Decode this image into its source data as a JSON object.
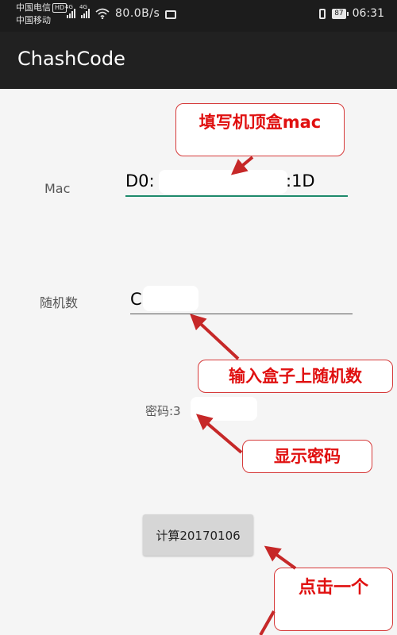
{
  "status_bar": {
    "carrier1": "中国电信",
    "hd_badge": "HD",
    "carrier2": "中国移动",
    "signal1_tag": "4G",
    "signal2_tag": "4G",
    "network_speed": "80.0B/s",
    "battery": "87",
    "time": "06:31",
    "icons": [
      "signal-icon",
      "wifi-icon",
      "briefcase-icon",
      "vibrate-icon",
      "battery-icon"
    ]
  },
  "app_bar": {
    "title": "ChashCode"
  },
  "form": {
    "mac_label": "Mac",
    "mac_value_start": "D0:",
    "mac_value_end": ":1D",
    "random_label": "随机数",
    "random_value": "C",
    "password_text": "密码:3",
    "calculate_button": "计算20170106"
  },
  "annotations": {
    "fill_mac": "填写机顶盒mac",
    "enter_random": "输入盒子上随机数",
    "show_password": "显示密码",
    "click_one": "点击一个"
  },
  "colors": {
    "status_bar_bg": "#1c1c1c",
    "app_bar_bg": "#212121",
    "page_bg": "#f5f5f5",
    "focus_underline": "#1e8a6b",
    "annotation_red": "#e01010",
    "arrow_red": "#c62828",
    "button_bg": "#d6d6d6"
  }
}
